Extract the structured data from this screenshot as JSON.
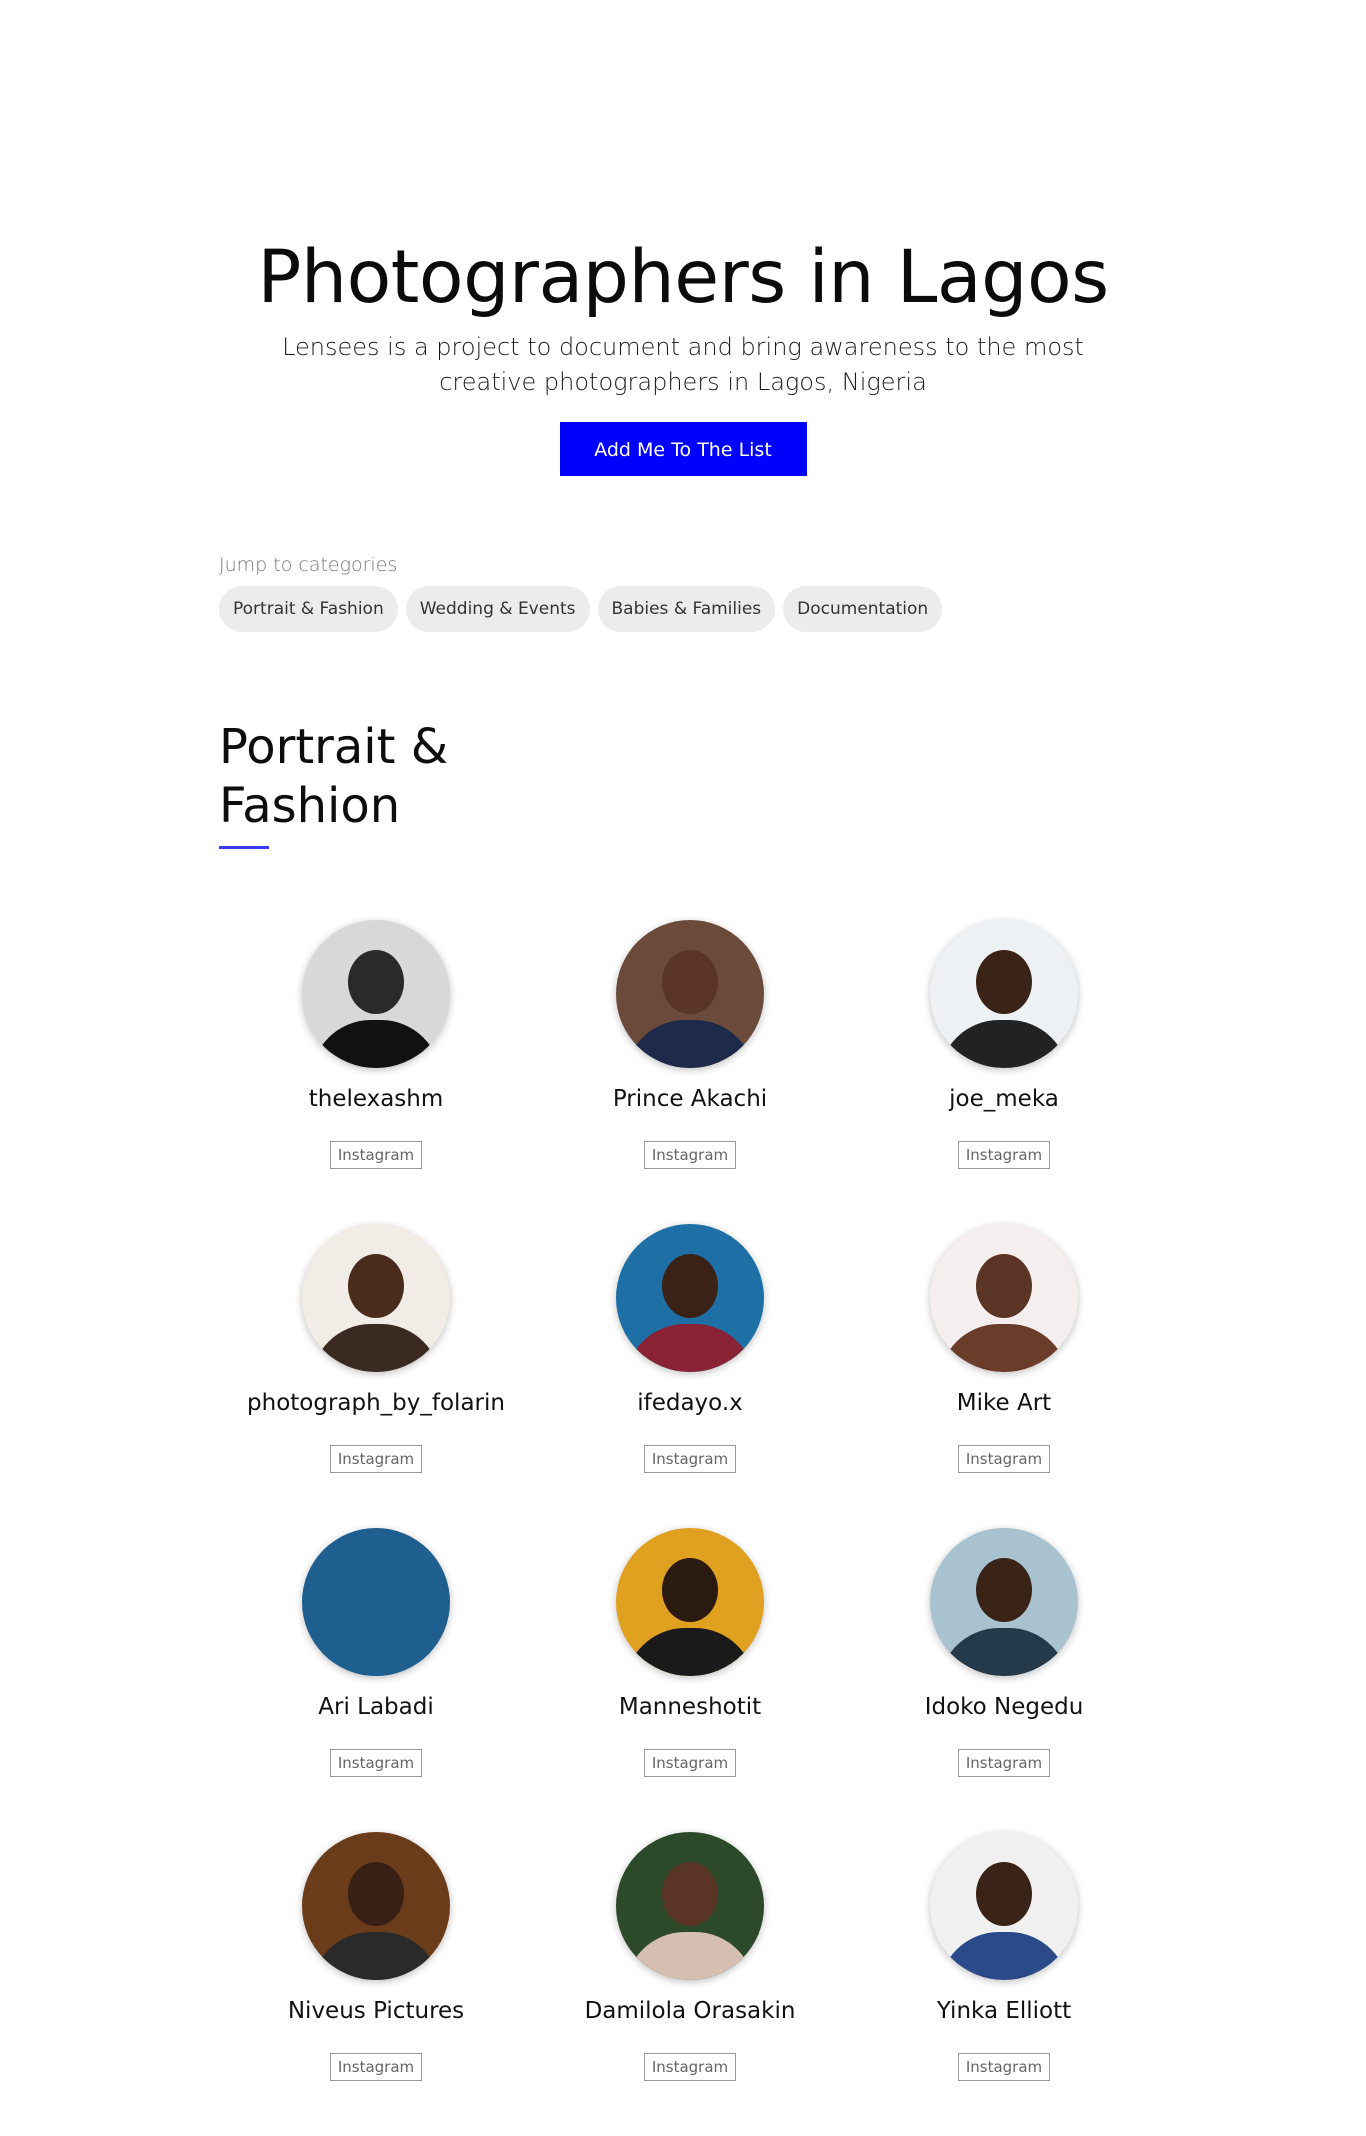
{
  "hero": {
    "title": "Photographers in Lagos",
    "tagline": "Lensees is a project to document and bring awareness to the most creative photographers in Lagos, Nigeria",
    "cta_label": "Add Me To The List"
  },
  "categories": {
    "label": "Jump to categories",
    "items": [
      "Portrait & Fashion",
      "Wedding & Events",
      "Babies & Families",
      "Documentation"
    ]
  },
  "section": {
    "title_line1": "Portrait &",
    "title_line2": "Fashion",
    "accent_color": "#3b3bff"
  },
  "photographers": [
    {
      "name": "thelexashm",
      "link": "Instagram",
      "avatar": {
        "bg": "#d8d8d8",
        "skin": "#2a2a2a",
        "shirt": "#111111"
      }
    },
    {
      "name": "Prince Akachi",
      "link": "Instagram",
      "avatar": {
        "bg": "#6b4a3c",
        "skin": "#5a3424",
        "shirt": "#1d2a4a"
      }
    },
    {
      "name": "joe_meka",
      "link": "Instagram",
      "avatar": {
        "bg": "#eef1f3",
        "skin": "#3a2418",
        "shirt": "#222222"
      }
    },
    {
      "name": "photograph_by_folarin",
      "link": "Instagram",
      "avatar": {
        "bg": "#f2ece6",
        "skin": "#4a2c1e",
        "shirt": "#3a2a22"
      }
    },
    {
      "name": "ifedayo.x",
      "link": "Instagram",
      "avatar": {
        "bg": "#1d6fa5",
        "skin": "#3b2216",
        "shirt": "#8a2236"
      }
    },
    {
      "name": "Mike Art",
      "link": "Instagram",
      "avatar": {
        "bg": "#f4efee",
        "skin": "#5a3424",
        "shirt": "#6a3c2a"
      }
    },
    {
      "name": "Ari Labadi",
      "link": "Instagram",
      "avatar": {
        "bg": "#1f5f8f",
        "skin": "#1f5f8f",
        "shirt": "#1f5f8f"
      }
    },
    {
      "name": "Manneshotit",
      "link": "Instagram",
      "avatar": {
        "bg": "#e0a020",
        "skin": "#2a1a10",
        "shirt": "#1a1a1a"
      }
    },
    {
      "name": "Idoko Negedu",
      "link": "Instagram",
      "avatar": {
        "bg": "#a9c2cf",
        "skin": "#3a2418",
        "shirt": "#243a4a"
      }
    },
    {
      "name": "Niveus Pictures",
      "link": "Instagram",
      "avatar": {
        "bg": "#6b3c1a",
        "skin": "#3a2014",
        "shirt": "#2a2a2a"
      }
    },
    {
      "name": "Damilola Orasakin",
      "link": "Instagram",
      "avatar": {
        "bg": "#2c4a2a",
        "skin": "#5a3424",
        "shirt": "#d4bfb0"
      }
    },
    {
      "name": "Yinka Elliott",
      "link": "Instagram",
      "avatar": {
        "bg": "#f0f0f0",
        "skin": "#3a2418",
        "shirt": "#2a4a8a"
      }
    }
  ]
}
